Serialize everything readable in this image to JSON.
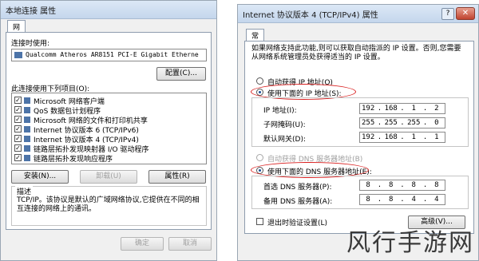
{
  "left": {
    "title": "本地连接 属性",
    "tab": "网络",
    "connect_using_label": "连接时使用:",
    "adapter": "Qualcomm Atheros AR8151 PCI-E Gigabit Etherne",
    "configure": "配置(C)...",
    "items_label": "此连接使用下列项目(O):",
    "items": [
      "Microsoft 网络客户端",
      "QoS 数据包计划程序",
      "Microsoft 网络的文件和打印机共享",
      "Internet 协议版本 6 (TCP/IPv6)",
      "Internet 协议版本 4 (TCP/IPv4)",
      "链路层拓扑发现映射器 I/O 驱动程序",
      "链路层拓扑发现响应程序"
    ],
    "install": "安装(N)...",
    "uninstall": "卸载(U)",
    "properties": "属性(R)",
    "desc_title": "描述",
    "desc_text": "TCP/IP。该协议是默认的广域网络协议,它提供在不同的相互连接的网络上的通讯。",
    "ok": "确定",
    "cancel": "取消"
  },
  "right": {
    "title": "Internet 协议版本 4 (TCP/IPv4) 属性",
    "tab": "常规",
    "info": "如果网络支持此功能,则可以获取自动指派的 IP 设置。否则,您需要从网络系统管理员处获得适当的 IP 设置。",
    "auto_ip": "自动获得 IP 地址(O)",
    "use_ip": "使用下面的 IP 地址(S):",
    "ip_label": "IP 地址(I):",
    "ip": [
      "192",
      "168",
      "1",
      "2"
    ],
    "mask_label": "子网掩码(U):",
    "mask": [
      "255",
      "255",
      "255",
      "0"
    ],
    "gw_label": "默认网关(D):",
    "gw": [
      "192",
      "168",
      "1",
      "1"
    ],
    "auto_dns": "自动获得 DNS 服务器地址(B)",
    "use_dns": "使用下面的 DNS 服务器地址(E):",
    "dns1_label": "首选 DNS 服务器(P):",
    "dns1": [
      "8",
      "8",
      "8",
      "8"
    ],
    "dns2_label": "备用 DNS 服务器(A):",
    "dns2": [
      "8",
      "8",
      "4",
      "4"
    ],
    "validate": "退出时验证设置(L)",
    "advanced": "高级(V)..."
  },
  "watermark": "风行手游网"
}
